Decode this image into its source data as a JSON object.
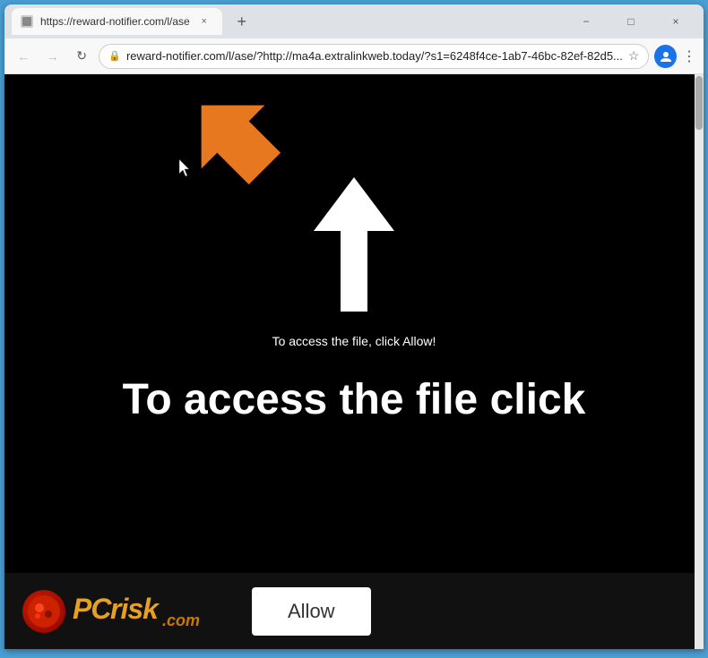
{
  "browser": {
    "title_bar": {
      "tab_title": "https://reward-notifier.com/l/ase",
      "tab_close_label": "×",
      "new_tab_label": "+",
      "minimize_label": "−",
      "maximize_label": "□",
      "close_label": "×"
    },
    "nav": {
      "back_label": "←",
      "forward_label": "→",
      "refresh_label": "↻",
      "address": "reward-notifier.com/l/ase/?http://ma4a.extralinkweb.today/?s1=6248f4ce-1ab7-46bc-82ef-82d5...",
      "lock_icon": "🔒",
      "star_label": "☆",
      "menu_label": "⋮"
    }
  },
  "page": {
    "small_instruction": "To access the file, click Allow!",
    "big_text": "To access the file click",
    "allow_button_label": "Allow",
    "watermark_text": "PC",
    "watermark_risk": "risk",
    "watermark_dotcom": ".com"
  },
  "colors": {
    "background": "#000000",
    "text_white": "#ffffff",
    "orange_accent": "#e87820",
    "allow_bg": "#ffffff"
  }
}
